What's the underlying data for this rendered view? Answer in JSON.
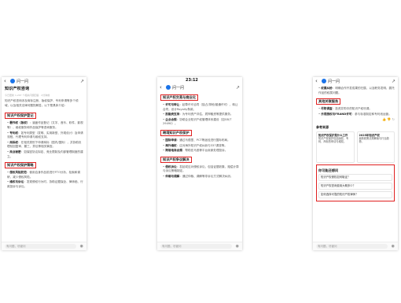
{
  "app": {
    "name": "问一问",
    "time": "23:12"
  },
  "panel1": {
    "title": "知识产权咨询",
    "meta": "今日更新 1,207 个相关问题回答 · 2分钟前",
    "intro": "知识产权咨询涉及商标注册、版权保护、专利申请等多个领域，以及相关法律问题的解答。以下是具体介绍：",
    "section1": "知识产权保护登记",
    "s1_items": [
      {
        "b": "著作权（版权）",
        "t": "：涵盖作品登记（文字、音乐、软件、影视等）、维权服务和作品保护等咨询服务。"
      },
      {
        "b": "专利权",
        "t": "：如专利类型（发明、实用新型、外观设计）及申请流程，代理专利申请与维权支持。"
      },
      {
        "b": "商标权",
        "t": "：在相关类别下申请商标（国内/国际），并协助处理驳回复审、撤三、异议等相关事宜。"
      },
      {
        "b": "商业秘密",
        "t": "：如保密协议拟定、竞业限制及内部管理制度的建立。"
      }
    ],
    "section2": "知识产权保护策略",
    "s2_items": [
      {
        "b": "侵权风险防范",
        "t": "：使用自身作品前进行FTO分析、检索和调研，减少侵权风险。"
      },
      {
        "b": "维权与诉讼",
        "t": "：发现侵权行为时，协助证据保全、律师函、行政投诉与诉讼。"
      }
    ]
  },
  "panel2": {
    "section1": "知识产权交易与商业化",
    "s1_items": [
      {
        "b": "许可与转让",
        "t": "：起草许可合同（独占/排他/普通许可）、转让合同，设计Royalty条款。"
      },
      {
        "b": "投融资支持",
        "t": "：为专利资产评估、质押融资等提供服务。"
      },
      {
        "b": "企业合规",
        "t": "：协助企业知识产权管理体系建设（如GB/T 29490）。"
      }
    ],
    "section2": "跨境知识产权保护",
    "s2_items": [
      {
        "b": "国际申请",
        "t": "：通过马德里、PCT等途径进行国际布局。"
      },
      {
        "b": "海外维权",
        "t": "：应对海外知识产权纠纷与337调查等。"
      },
      {
        "b": "跨境电商合规",
        "t": "：帮助亚马逊等平台卖家处理投诉。"
      }
    ],
    "section3": "知识产权争议解决",
    "s3_items": [
      {
        "b": "侵权诉讼",
        "t": "：发起或应对侵权诉讼，包括证据收集、赔偿计算与诉讼策略制定。"
      },
      {
        "b": "仲裁与调解",
        "t": "：通过仲裁、调解等非诉讼方式解决纠纷。"
      }
    ]
  },
  "panel3": {
    "top_items": [
      {
        "b": "权属纠纷",
        "t": "：明确合作开发成果的归属，以及职务发明、委托作品的权属问题。"
      }
    ],
    "section1": "其他关联服务",
    "s1_items": [
      {
        "b": "尽职调查",
        "t": "：投资并购中的知识产权尽调。"
      },
      {
        "b": "乐观授权与FRAND许可",
        "t": "：参与标准制定和专利池运营。"
      }
    ],
    "related_title": "参考来源",
    "cards": [
      {
        "title": "知识产权保护是什么工作",
        "text": "知识产权保护包括版权、专利、商标的申请与维权。"
      },
      {
        "title": "2025年知识产权",
        "text": "最新政策法规解读与行业趋势。"
      }
    ],
    "ask_title": "你可能还想问",
    "asks": [
      "知识产权侵权如何取证？",
      "知识产权咨询费用大概多少？",
      "如何选择可靠的知识产权律师？"
    ],
    "input_placeholder": "有问题，尽管问"
  }
}
